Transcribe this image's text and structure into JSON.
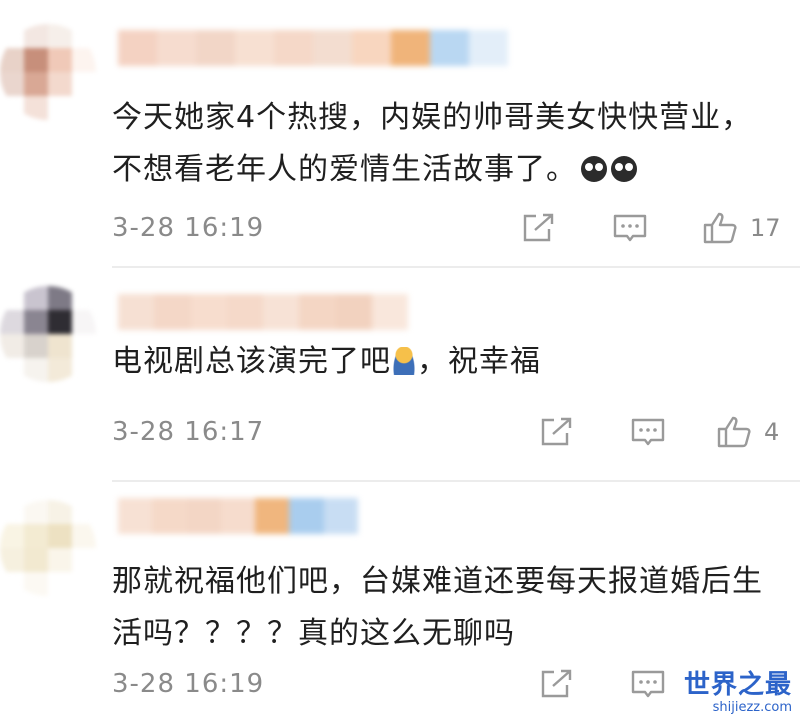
{
  "comments": [
    {
      "text": "今天她家4个热搜，内娱的帅哥美女快快营业，不想看老年人的爱情生活故事了。",
      "emoji": "crying-face-emoji",
      "time": "3-28 16:19",
      "likes": "17"
    },
    {
      "text_before": "电视剧总该演完了吧",
      "emoji": "sitting-person-emoji",
      "text_after": "，祝幸福",
      "time": "3-28 16:17",
      "likes": "4"
    },
    {
      "text": "那就祝福他们吧，台媒难道还要每天报道婚后生活吗？？？？真的这么无聊吗",
      "time": "3-28 16:19",
      "likes": ""
    }
  ],
  "watermark": {
    "title": "世界之最",
    "url": "shijiezz.com"
  },
  "colors": {
    "meta_gray": "#8a8a8a",
    "icon_gray": "#9a9a9a",
    "divider": "#ececec",
    "watermark_blue": "#2c63c9"
  },
  "icons": [
    "share-icon",
    "comment-icon",
    "thumbs-up-icon"
  ]
}
